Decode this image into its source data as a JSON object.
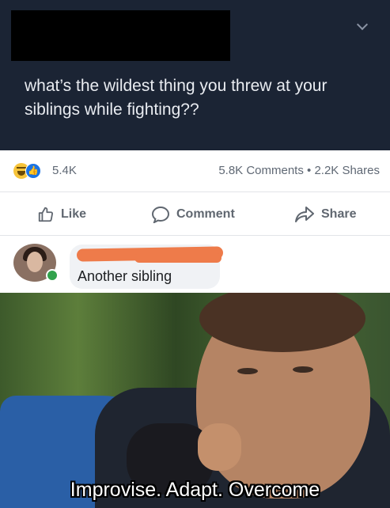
{
  "post": {
    "text": "what’s the wildest thing you threw at your siblings while fighting??"
  },
  "reactions": {
    "count": "5.4K",
    "stats": "5.8K Comments • 2.2K Shares",
    "icons": [
      "haha-reaction-icon",
      "like-reaction-icon"
    ]
  },
  "actions": {
    "like": "Like",
    "comment": "Comment",
    "share": "Share"
  },
  "comment": {
    "text": "Another sibling"
  },
  "meme": {
    "caption": "Improvise. Adapt. Overcome"
  },
  "colors": {
    "post_bg": "#1b2434",
    "like_blue": "#1b74e4",
    "online_green": "#31a24c",
    "redaction_orange": "#ee7b4a"
  }
}
